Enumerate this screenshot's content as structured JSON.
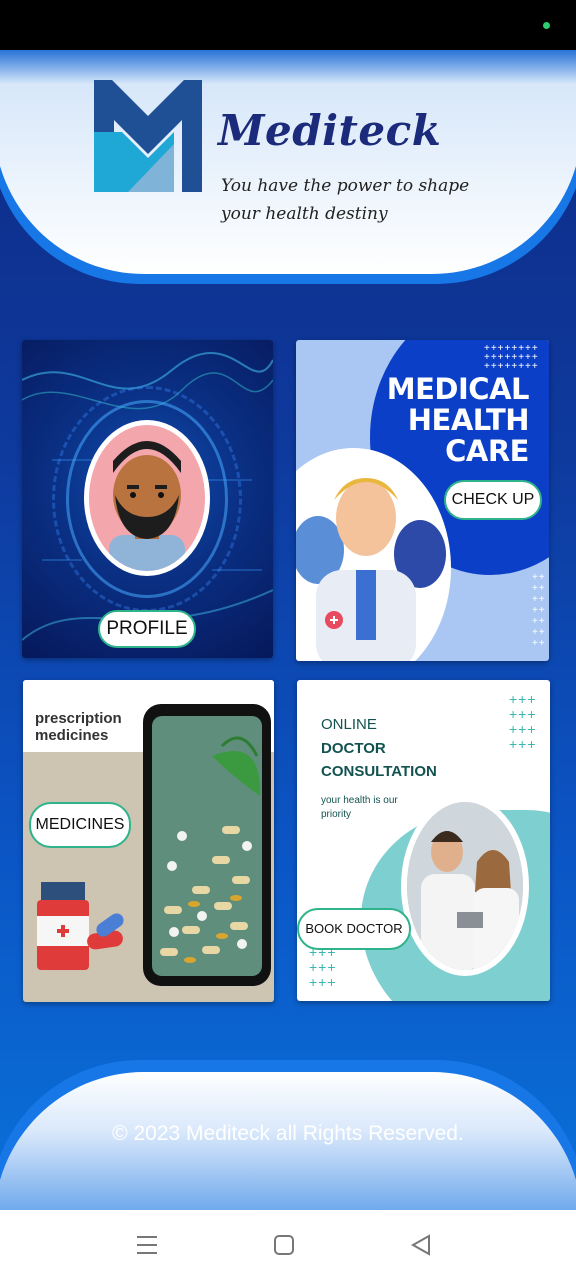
{
  "app": {
    "brand_name": "Mediteck",
    "tagline": "You have the power to shape your health destiny"
  },
  "cards": {
    "profile": {
      "button_label": "PROFILE"
    },
    "checkup": {
      "title_line1": "MEDICAL",
      "title_line2": "HEALTH",
      "title_line3": "CARE",
      "button_label": "CHECK UP"
    },
    "medicines": {
      "label": "prescription medicines",
      "button_label": "MEDICINES"
    },
    "doctor": {
      "line1": "ONLINE",
      "line2": "DOCTOR",
      "line3": "CONSULTATION",
      "subtext": "your health is our priority",
      "button_label": "BOOK DOCTOR"
    }
  },
  "footer": {
    "copyright": "© 2023 Mediteck all Rights Reserved."
  },
  "nav": {
    "menu_icon": "menu-icon",
    "home_icon": "home-square-icon",
    "back_icon": "back-triangle-icon"
  },
  "colors": {
    "accent": "#1877e6",
    "brand_dark": "#1b2a7a",
    "button_border": "#2fb38a",
    "status_dot": "#2ecc71"
  }
}
